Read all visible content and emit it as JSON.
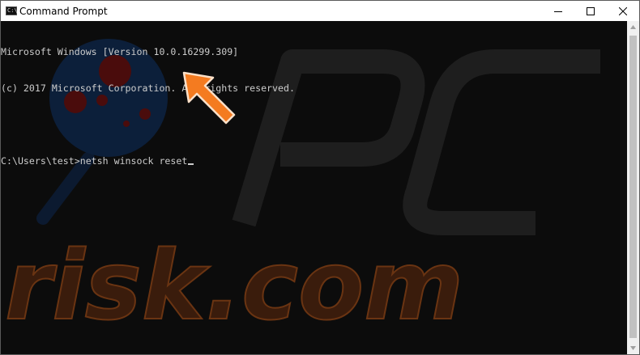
{
  "window": {
    "title": "Command Prompt",
    "app_icon_text": "C:\\"
  },
  "controls": {
    "minimize_icon": "minimize-icon",
    "maximize_icon": "maximize-icon",
    "close_icon": "close-icon"
  },
  "console": {
    "lines": [
      "Microsoft Windows [Version 10.0.16299.309]",
      "(c) 2017 Microsoft Corporation. All rights reserved.",
      "",
      "C:\\Users\\test>netsh winsock reset"
    ]
  },
  "watermark": {
    "text": "risk.com",
    "logo_letters": "PC"
  },
  "colors": {
    "console_bg": "#0c0c0c",
    "console_text": "#cccccc",
    "arrow": "#f47b20",
    "watermark_orange": "#8a3f10"
  }
}
